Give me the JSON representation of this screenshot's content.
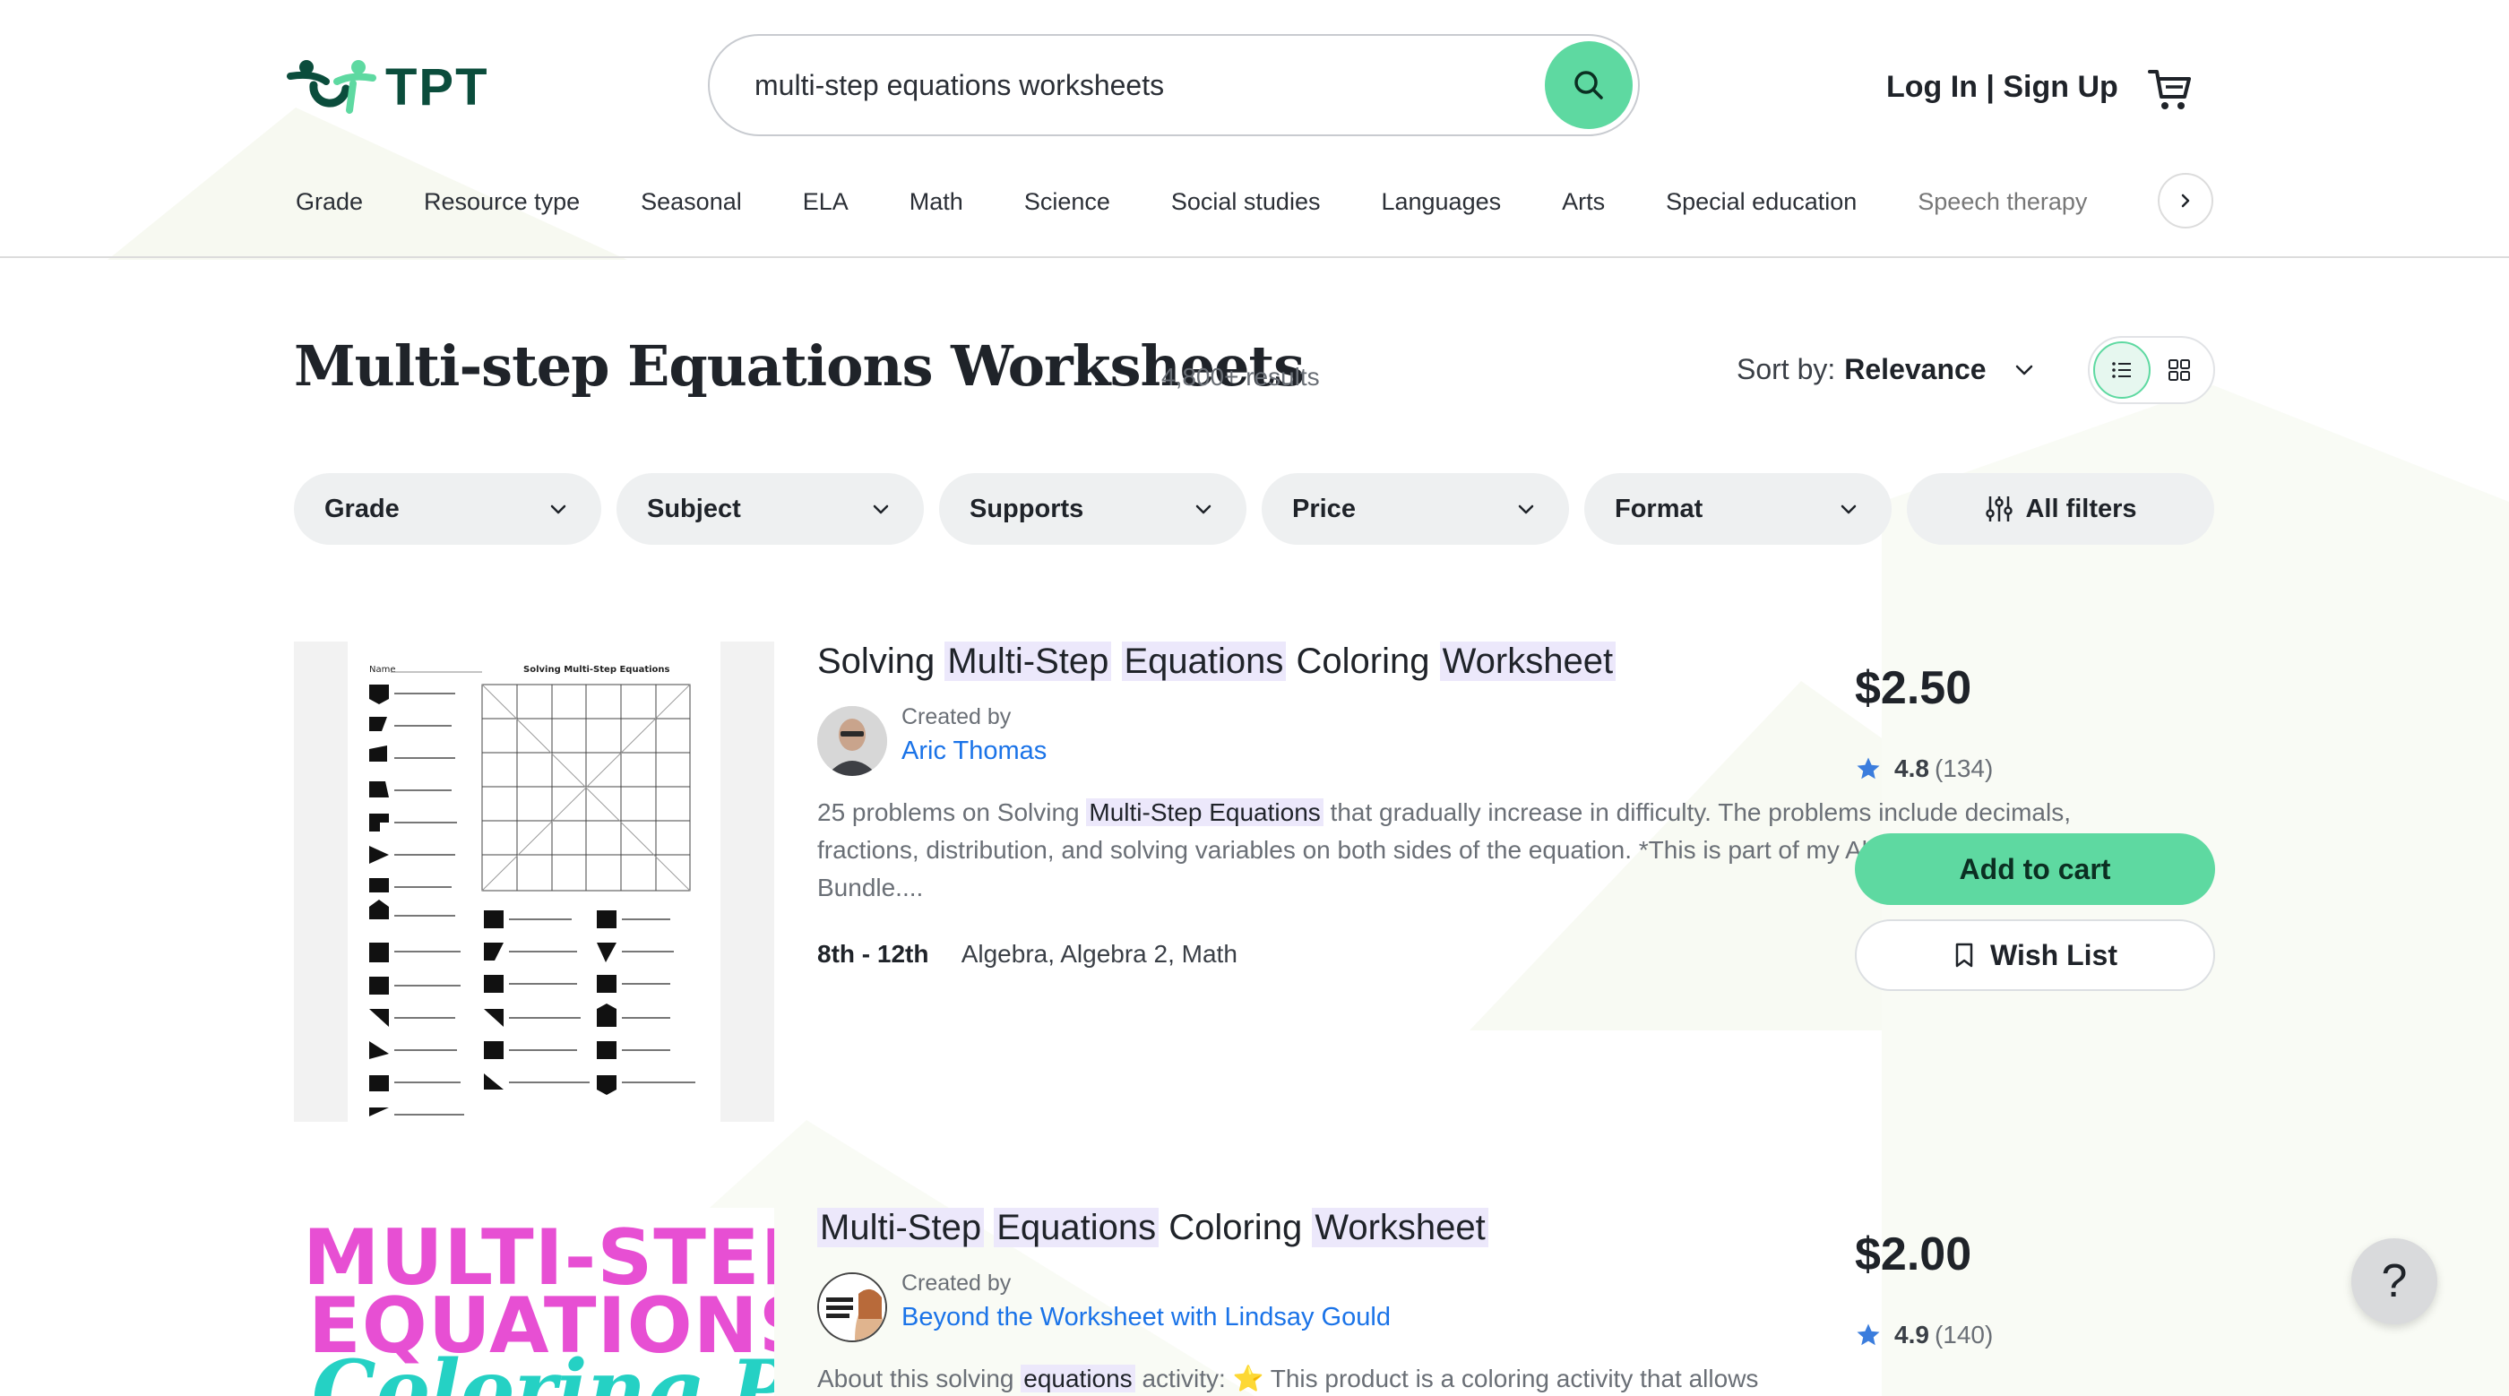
{
  "header": {
    "logo_text": "TPT",
    "search": {
      "value": "multi-step equations worksheets",
      "placeholder": ""
    },
    "auth_label": "Log In | Sign Up"
  },
  "nav": {
    "items": [
      {
        "label": "Grade"
      },
      {
        "label": "Resource type"
      },
      {
        "label": "Seasonal"
      },
      {
        "label": "ELA"
      },
      {
        "label": "Math"
      },
      {
        "label": "Science"
      },
      {
        "label": "Social studies"
      },
      {
        "label": "Languages"
      },
      {
        "label": "Arts"
      },
      {
        "label": "Special education"
      },
      {
        "label": "Speech therapy"
      }
    ]
  },
  "results_header": {
    "title": "Multi-step Equations Worksheets",
    "count": "4,800+ results",
    "sort_label": "Sort by:",
    "sort_value": "Relevance"
  },
  "filters": [
    {
      "label": "Grade"
    },
    {
      "label": "Subject"
    },
    {
      "label": "Supports"
    },
    {
      "label": "Price"
    },
    {
      "label": "Format"
    },
    {
      "label": "All filters"
    }
  ],
  "products": [
    {
      "title_parts": [
        "Solving ",
        "Multi-Step",
        " ",
        "Equations",
        " Coloring ",
        "Worksheet"
      ],
      "created_by_label": "Created by",
      "creator": "Aric Thomas",
      "description_parts": [
        "25 problems on Solving ",
        "Multi-Step Equations",
        " that gradually increase in difficulty. The problems include decimals, fractions, distribution, and solving variables on both sides of the equation. *This is part of my Algebra Workbook Bundle...."
      ],
      "grade": "8th - 12th",
      "subjects": "Algebra, Algebra 2, Math",
      "price": "$2.50",
      "rating": "4.8",
      "rating_count": "(134)",
      "add_to_cart": "Add to cart",
      "wish_list": "Wish List",
      "thumb_name": "Name",
      "thumb_title": "Solving Multi-Step Equations"
    },
    {
      "title_parts": [
        "Multi-Step",
        " ",
        "Equations",
        " Coloring ",
        "Worksheet"
      ],
      "created_by_label": "Created by",
      "creator": "Beyond the Worksheet with Lindsay Gould",
      "description_parts": [
        "About this solving ",
        "equations",
        " activity: ⭐ This product is a coloring activity that allows"
      ],
      "price": "$2.00",
      "rating": "4.9",
      "rating_count": "(140)",
      "thumb_line1": "MULTI-STEP",
      "thumb_line2": "EQUATIONS",
      "thumb_line3": "Coloring Page"
    }
  ],
  "help_label": "?",
  "colors": {
    "accent_green": "#5ed9a1",
    "brand_dark_green": "#0b4d3c",
    "link_blue": "#1a73e8",
    "highlight": "#ece8fb",
    "star_blue": "#3b7ddd"
  }
}
